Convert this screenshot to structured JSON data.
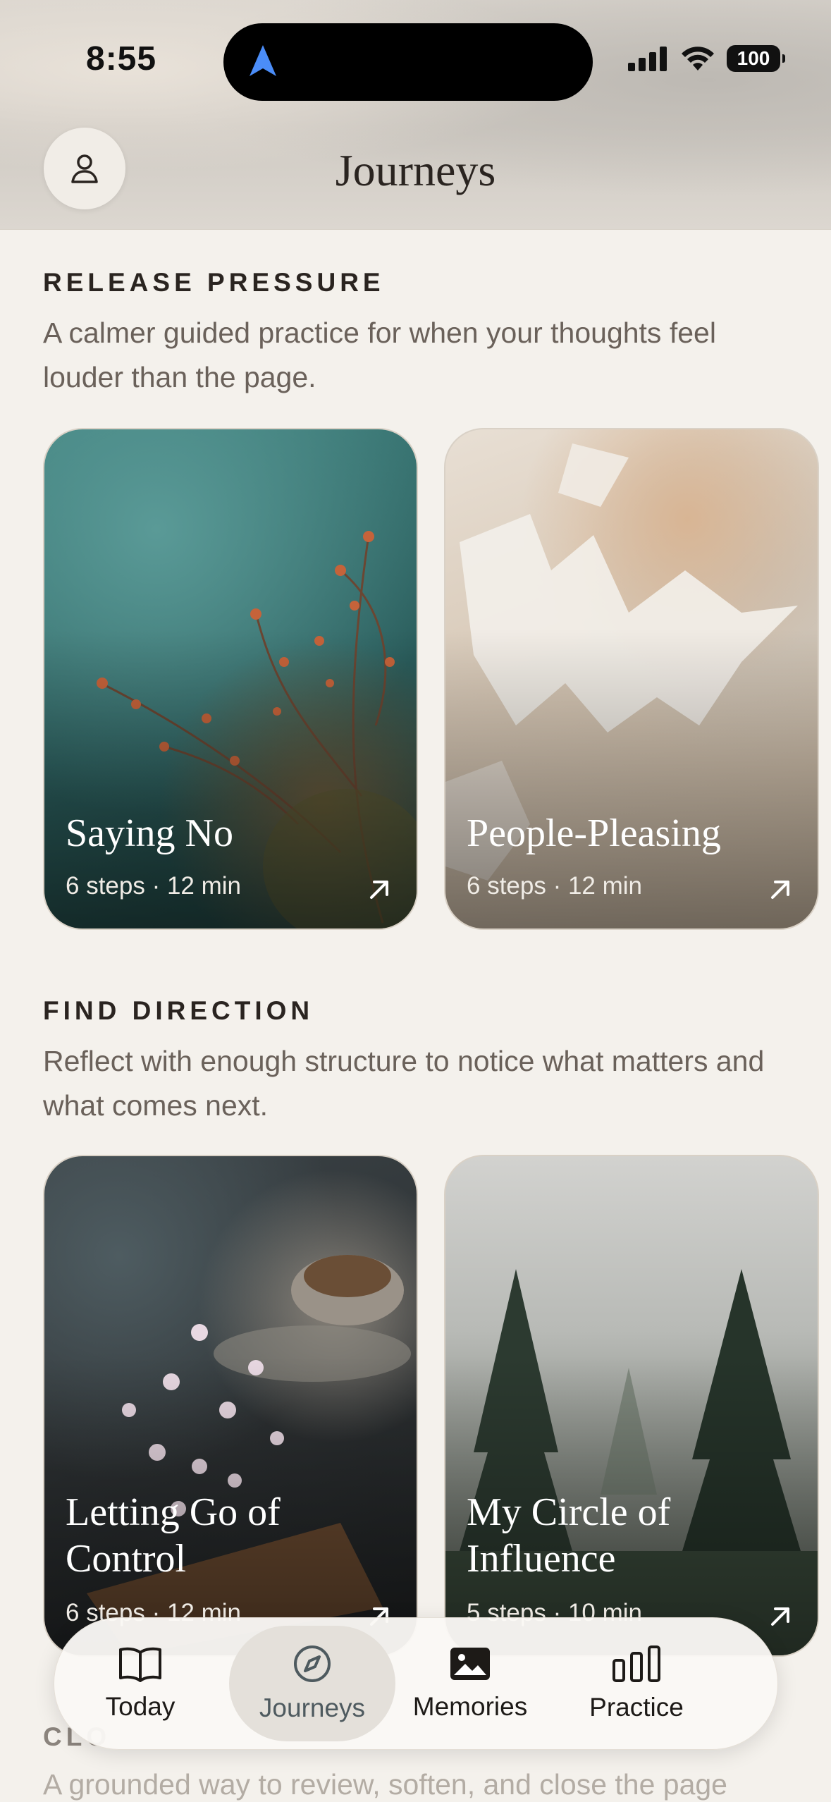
{
  "status_bar": {
    "time": "8:55",
    "battery": "100"
  },
  "header": {
    "title": "Journeys"
  },
  "sections": [
    {
      "heading": "RELEASE PRESSURE",
      "description": "A calmer guided practice for when your thoughts feel louder than the page.",
      "cards": [
        {
          "title": "Saying No",
          "meta": "6 steps · 12 min"
        },
        {
          "title": "People-Pleasing",
          "meta": "6 steps · 12 min"
        }
      ]
    },
    {
      "heading": "FIND DIRECTION",
      "description": "Reflect with enough structure to notice what matters and what comes next.",
      "cards": [
        {
          "title": "Letting Go of Control",
          "meta": "6 steps · 12 min"
        },
        {
          "title": "My Circle of Influence",
          "meta": "5 steps · 10 min"
        }
      ]
    },
    {
      "heading": "CLO",
      "description": "A grounded way to review, soften, and close the page"
    }
  ],
  "tabbar": {
    "tabs": [
      {
        "label": "Today",
        "icon": "book-icon"
      },
      {
        "label": "Journeys",
        "icon": "compass-icon"
      },
      {
        "label": "Memories",
        "icon": "photo-icon"
      },
      {
        "label": "Practice",
        "icon": "bar-chart-icon"
      }
    ],
    "active": "Journeys"
  }
}
